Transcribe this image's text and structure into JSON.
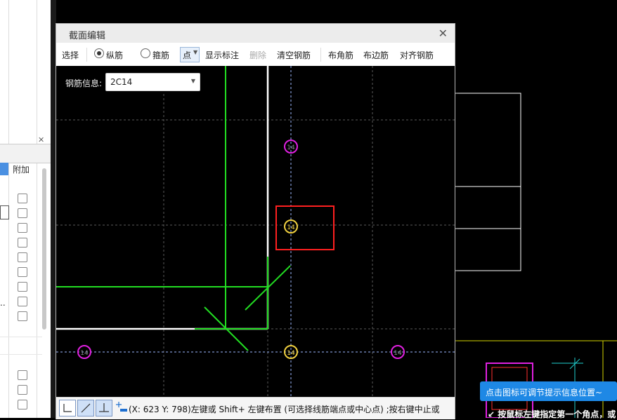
{
  "dialog": {
    "title": "截面编辑",
    "toolbar": {
      "select": "选择",
      "longitudinal": "纵筋",
      "stirrup": "箍筋",
      "point": "点",
      "show_annotation": "显示标注",
      "delete": "删除",
      "clear_rebar": "清空钢筋",
      "corner_rebar": "布角筋",
      "edge_rebar": "布边筋",
      "align_rebar": "对齐钢筋"
    },
    "rebar_info_label": "钢筋信息:",
    "rebar_info_value": "2C14",
    "rebar_marker_label": "14"
  },
  "left_panel": {
    "column_header": "附加"
  },
  "status": {
    "text": "(X: 623 Y: 798)左键或 Shift+ 左键布置 (可选择线筋端点或中心点) ;按右键中止或"
  },
  "tooltip": "点击图标可调节提示信息位置~",
  "bottom_hint": "按鼠标左键指定第一个角点，或",
  "colors": {
    "selected_marker": "#f0d040",
    "normal_marker": "#e020e0",
    "highlight_box": "#ff2020",
    "outline_green": "#22dd22",
    "outline_white": "#ffffff"
  }
}
